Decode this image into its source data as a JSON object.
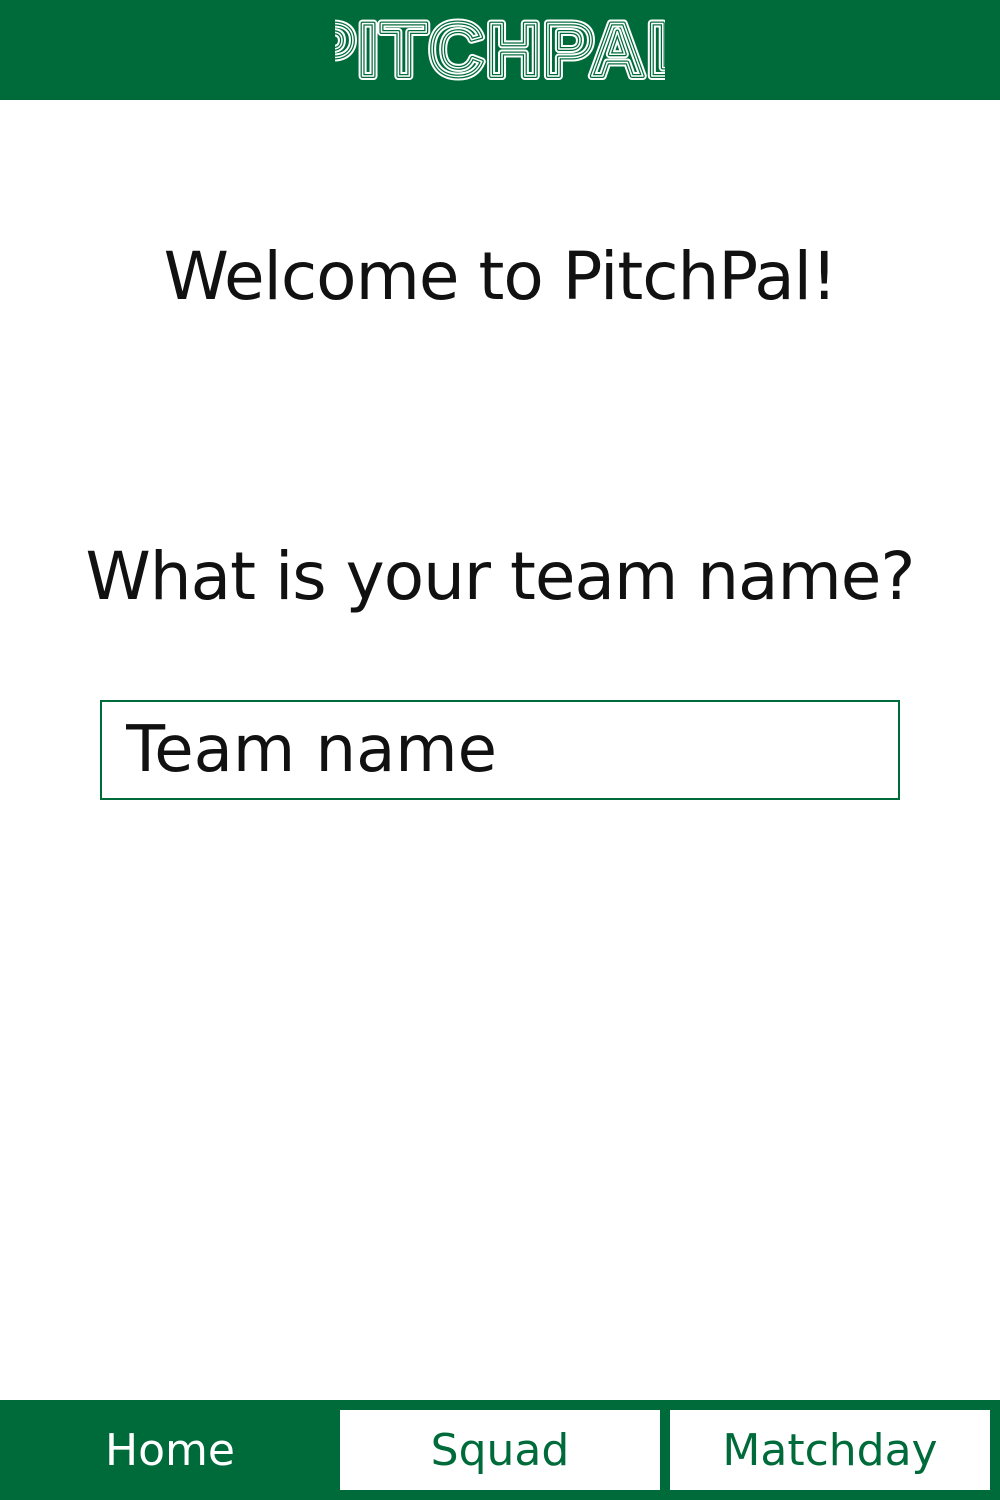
{
  "header": {
    "logo_text": "PITCHPAL",
    "background": "#006b3a"
  },
  "main": {
    "welcome_text": "Welcome to PitchPal!",
    "question_text": "What is your team name?",
    "team_input": {
      "value": "",
      "placeholder": "Team name"
    }
  },
  "nav": {
    "items": [
      {
        "label": "Home",
        "active": true
      },
      {
        "label": "Squad",
        "active": false
      },
      {
        "label": "Matchday",
        "active": false
      }
    ]
  },
  "colors": {
    "brand": "#006b3a",
    "text": "#111111",
    "background": "#ffffff"
  }
}
